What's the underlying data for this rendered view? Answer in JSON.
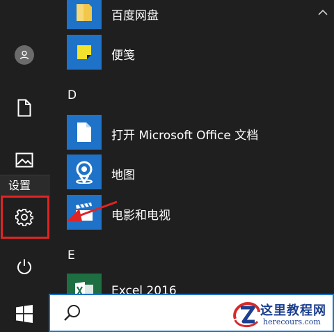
{
  "rail": {
    "items": [
      {
        "name": "user-account",
        "icon": "person-icon"
      },
      {
        "name": "documents",
        "icon": "document-icon"
      },
      {
        "name": "pictures",
        "icon": "image-icon"
      },
      {
        "name": "settings",
        "icon": "gear-icon"
      },
      {
        "name": "power",
        "icon": "power-icon"
      }
    ],
    "tooltip": "设置"
  },
  "apps": [
    {
      "label": "百度网盘",
      "icon": "folder-icon"
    },
    {
      "label": "便笺",
      "icon": "sticky-note-icon"
    },
    {
      "section": "D"
    },
    {
      "label": "打开 Microsoft Office 文档",
      "icon": "document-icon"
    },
    {
      "label": "地图",
      "icon": "map-pin-icon"
    },
    {
      "label": "电影和电视",
      "icon": "clapperboard-icon"
    },
    {
      "section": "E"
    },
    {
      "label": "Excel 2016",
      "icon": "excel-icon"
    }
  ],
  "taskbar": {
    "search_icon": "search-icon",
    "start_icon": "windows-logo-icon"
  },
  "watermark": {
    "title": "这里教程网",
    "subtitle": "herecours.com"
  },
  "colors": {
    "background": "#1f1f1f",
    "tile_blue": "#1e73c8",
    "highlight_red": "#e02424",
    "excel_green": "#1d6f42"
  }
}
